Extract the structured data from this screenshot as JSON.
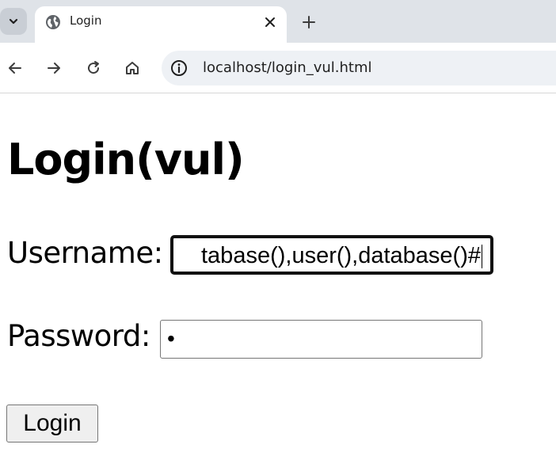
{
  "browser": {
    "tab": {
      "title": "Login",
      "favicon": "globe-icon"
    },
    "address": {
      "url": "localhost/login_vul.html"
    }
  },
  "page": {
    "heading": "Login(vul)",
    "username_label": "Username:",
    "username_value": "tabase(),user(),database()#",
    "password_label": "Password:",
    "password_value": "•",
    "login_button": "Login"
  },
  "colors": {
    "tabstrip_bg": "#dfe3e8",
    "omnibox_bg": "#eef1f5",
    "focus_border": "#101010"
  }
}
